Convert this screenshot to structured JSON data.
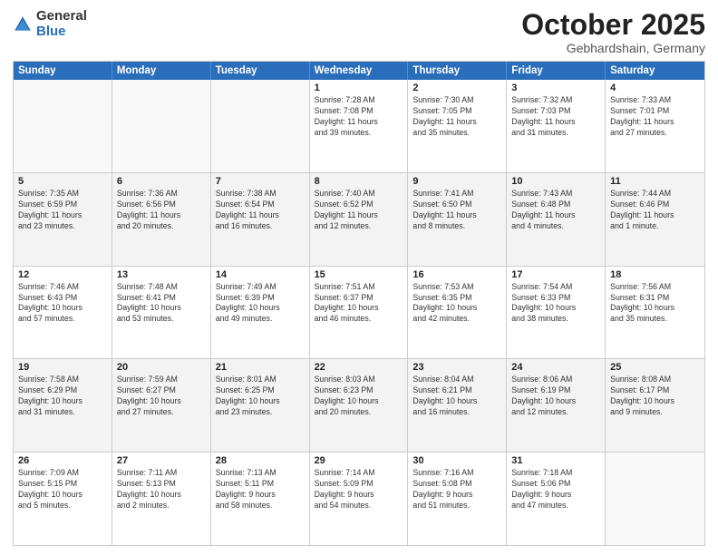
{
  "logo": {
    "general": "General",
    "blue": "Blue"
  },
  "header": {
    "month": "October 2025",
    "location": "Gebhardshain, Germany"
  },
  "weekdays": [
    "Sunday",
    "Monday",
    "Tuesday",
    "Wednesday",
    "Thursday",
    "Friday",
    "Saturday"
  ],
  "rows": [
    [
      {
        "day": "",
        "lines": [],
        "empty": true
      },
      {
        "day": "",
        "lines": [],
        "empty": true
      },
      {
        "day": "",
        "lines": [],
        "empty": true
      },
      {
        "day": "1",
        "lines": [
          "Sunrise: 7:28 AM",
          "Sunset: 7:08 PM",
          "Daylight: 11 hours",
          "and 39 minutes."
        ],
        "empty": false
      },
      {
        "day": "2",
        "lines": [
          "Sunrise: 7:30 AM",
          "Sunset: 7:05 PM",
          "Daylight: 11 hours",
          "and 35 minutes."
        ],
        "empty": false
      },
      {
        "day": "3",
        "lines": [
          "Sunrise: 7:32 AM",
          "Sunset: 7:03 PM",
          "Daylight: 11 hours",
          "and 31 minutes."
        ],
        "empty": false
      },
      {
        "day": "4",
        "lines": [
          "Sunrise: 7:33 AM",
          "Sunset: 7:01 PM",
          "Daylight: 11 hours",
          "and 27 minutes."
        ],
        "empty": false
      }
    ],
    [
      {
        "day": "5",
        "lines": [
          "Sunrise: 7:35 AM",
          "Sunset: 6:59 PM",
          "Daylight: 11 hours",
          "and 23 minutes."
        ],
        "empty": false
      },
      {
        "day": "6",
        "lines": [
          "Sunrise: 7:36 AM",
          "Sunset: 6:56 PM",
          "Daylight: 11 hours",
          "and 20 minutes."
        ],
        "empty": false
      },
      {
        "day": "7",
        "lines": [
          "Sunrise: 7:38 AM",
          "Sunset: 6:54 PM",
          "Daylight: 11 hours",
          "and 16 minutes."
        ],
        "empty": false
      },
      {
        "day": "8",
        "lines": [
          "Sunrise: 7:40 AM",
          "Sunset: 6:52 PM",
          "Daylight: 11 hours",
          "and 12 minutes."
        ],
        "empty": false
      },
      {
        "day": "9",
        "lines": [
          "Sunrise: 7:41 AM",
          "Sunset: 6:50 PM",
          "Daylight: 11 hours",
          "and 8 minutes."
        ],
        "empty": false
      },
      {
        "day": "10",
        "lines": [
          "Sunrise: 7:43 AM",
          "Sunset: 6:48 PM",
          "Daylight: 11 hours",
          "and 4 minutes."
        ],
        "empty": false
      },
      {
        "day": "11",
        "lines": [
          "Sunrise: 7:44 AM",
          "Sunset: 6:46 PM",
          "Daylight: 11 hours",
          "and 1 minute."
        ],
        "empty": false
      }
    ],
    [
      {
        "day": "12",
        "lines": [
          "Sunrise: 7:46 AM",
          "Sunset: 6:43 PM",
          "Daylight: 10 hours",
          "and 57 minutes."
        ],
        "empty": false
      },
      {
        "day": "13",
        "lines": [
          "Sunrise: 7:48 AM",
          "Sunset: 6:41 PM",
          "Daylight: 10 hours",
          "and 53 minutes."
        ],
        "empty": false
      },
      {
        "day": "14",
        "lines": [
          "Sunrise: 7:49 AM",
          "Sunset: 6:39 PM",
          "Daylight: 10 hours",
          "and 49 minutes."
        ],
        "empty": false
      },
      {
        "day": "15",
        "lines": [
          "Sunrise: 7:51 AM",
          "Sunset: 6:37 PM",
          "Daylight: 10 hours",
          "and 46 minutes."
        ],
        "empty": false
      },
      {
        "day": "16",
        "lines": [
          "Sunrise: 7:53 AM",
          "Sunset: 6:35 PM",
          "Daylight: 10 hours",
          "and 42 minutes."
        ],
        "empty": false
      },
      {
        "day": "17",
        "lines": [
          "Sunrise: 7:54 AM",
          "Sunset: 6:33 PM",
          "Daylight: 10 hours",
          "and 38 minutes."
        ],
        "empty": false
      },
      {
        "day": "18",
        "lines": [
          "Sunrise: 7:56 AM",
          "Sunset: 6:31 PM",
          "Daylight: 10 hours",
          "and 35 minutes."
        ],
        "empty": false
      }
    ],
    [
      {
        "day": "19",
        "lines": [
          "Sunrise: 7:58 AM",
          "Sunset: 6:29 PM",
          "Daylight: 10 hours",
          "and 31 minutes."
        ],
        "empty": false
      },
      {
        "day": "20",
        "lines": [
          "Sunrise: 7:59 AM",
          "Sunset: 6:27 PM",
          "Daylight: 10 hours",
          "and 27 minutes."
        ],
        "empty": false
      },
      {
        "day": "21",
        "lines": [
          "Sunrise: 8:01 AM",
          "Sunset: 6:25 PM",
          "Daylight: 10 hours",
          "and 23 minutes."
        ],
        "empty": false
      },
      {
        "day": "22",
        "lines": [
          "Sunrise: 8:03 AM",
          "Sunset: 6:23 PM",
          "Daylight: 10 hours",
          "and 20 minutes."
        ],
        "empty": false
      },
      {
        "day": "23",
        "lines": [
          "Sunrise: 8:04 AM",
          "Sunset: 6:21 PM",
          "Daylight: 10 hours",
          "and 16 minutes."
        ],
        "empty": false
      },
      {
        "day": "24",
        "lines": [
          "Sunrise: 8:06 AM",
          "Sunset: 6:19 PM",
          "Daylight: 10 hours",
          "and 12 minutes."
        ],
        "empty": false
      },
      {
        "day": "25",
        "lines": [
          "Sunrise: 8:08 AM",
          "Sunset: 6:17 PM",
          "Daylight: 10 hours",
          "and 9 minutes."
        ],
        "empty": false
      }
    ],
    [
      {
        "day": "26",
        "lines": [
          "Sunrise: 7:09 AM",
          "Sunset: 5:15 PM",
          "Daylight: 10 hours",
          "and 5 minutes."
        ],
        "empty": false
      },
      {
        "day": "27",
        "lines": [
          "Sunrise: 7:11 AM",
          "Sunset: 5:13 PM",
          "Daylight: 10 hours",
          "and 2 minutes."
        ],
        "empty": false
      },
      {
        "day": "28",
        "lines": [
          "Sunrise: 7:13 AM",
          "Sunset: 5:11 PM",
          "Daylight: 9 hours",
          "and 58 minutes."
        ],
        "empty": false
      },
      {
        "day": "29",
        "lines": [
          "Sunrise: 7:14 AM",
          "Sunset: 5:09 PM",
          "Daylight: 9 hours",
          "and 54 minutes."
        ],
        "empty": false
      },
      {
        "day": "30",
        "lines": [
          "Sunrise: 7:16 AM",
          "Sunset: 5:08 PM",
          "Daylight: 9 hours",
          "and 51 minutes."
        ],
        "empty": false
      },
      {
        "day": "31",
        "lines": [
          "Sunrise: 7:18 AM",
          "Sunset: 5:06 PM",
          "Daylight: 9 hours",
          "and 47 minutes."
        ],
        "empty": false
      },
      {
        "day": "",
        "lines": [],
        "empty": true
      }
    ]
  ]
}
